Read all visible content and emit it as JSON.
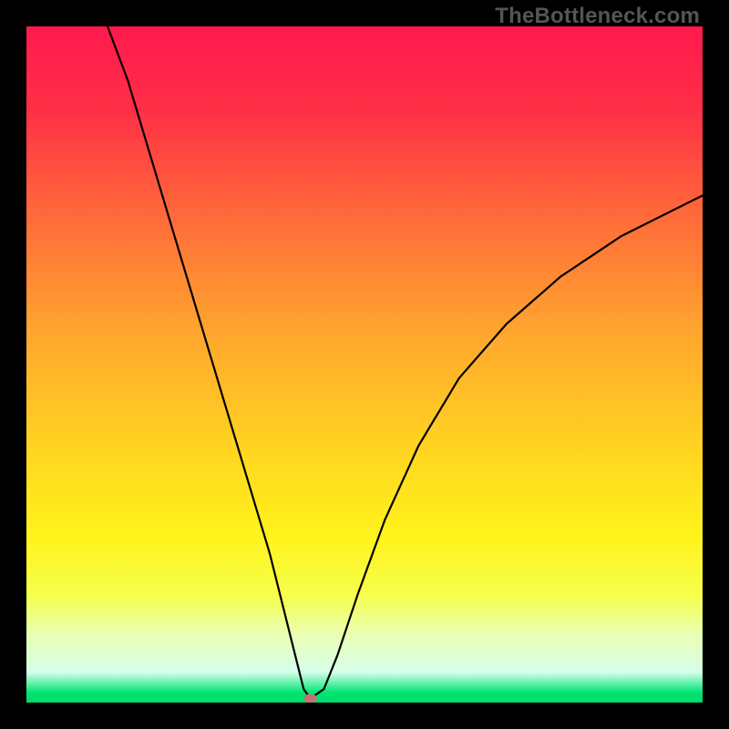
{
  "watermark": "TheBottleneck.com",
  "colors": {
    "background": "#000000",
    "curve": "#000000",
    "marker": "#c77070",
    "gradient_stops": [
      {
        "offset": 0.0,
        "color": "#ff1a4d"
      },
      {
        "offset": 0.12,
        "color": "#ff2e46"
      },
      {
        "offset": 0.28,
        "color": "#ff6a3a"
      },
      {
        "offset": 0.45,
        "color": "#ffa52e"
      },
      {
        "offset": 0.62,
        "color": "#ffd321"
      },
      {
        "offset": 0.75,
        "color": "#fff21a"
      },
      {
        "offset": 0.84,
        "color": "#f6ff4a"
      },
      {
        "offset": 0.9,
        "color": "#eaffb5"
      },
      {
        "offset": 0.955,
        "color": "#d6ffea"
      },
      {
        "offset": 0.985,
        "color": "#00e673"
      },
      {
        "offset": 1.0,
        "color": "#00d966"
      }
    ]
  },
  "chart_data": {
    "type": "line",
    "title": "",
    "xlabel": "",
    "ylabel": "",
    "xlim": [
      0,
      100
    ],
    "ylim": [
      0,
      100
    ],
    "minimum_x": 42,
    "marker": {
      "x": 42,
      "y": 0.6
    },
    "left_curve": [
      {
        "x": 12,
        "y": 100
      },
      {
        "x": 15,
        "y": 92
      },
      {
        "x": 18,
        "y": 82
      },
      {
        "x": 21,
        "y": 72
      },
      {
        "x": 24,
        "y": 62
      },
      {
        "x": 27,
        "y": 52
      },
      {
        "x": 30,
        "y": 42
      },
      {
        "x": 33,
        "y": 32
      },
      {
        "x": 36,
        "y": 22
      },
      {
        "x": 38,
        "y": 14
      },
      {
        "x": 40,
        "y": 6
      },
      {
        "x": 41,
        "y": 2
      },
      {
        "x": 42,
        "y": 0.6
      }
    ],
    "right_curve": [
      {
        "x": 42,
        "y": 0.6
      },
      {
        "x": 44,
        "y": 2
      },
      {
        "x": 46,
        "y": 7
      },
      {
        "x": 49,
        "y": 16
      },
      {
        "x": 53,
        "y": 27
      },
      {
        "x": 58,
        "y": 38
      },
      {
        "x": 64,
        "y": 48
      },
      {
        "x": 71,
        "y": 56
      },
      {
        "x": 79,
        "y": 63
      },
      {
        "x": 88,
        "y": 69
      },
      {
        "x": 100,
        "y": 75
      }
    ]
  }
}
